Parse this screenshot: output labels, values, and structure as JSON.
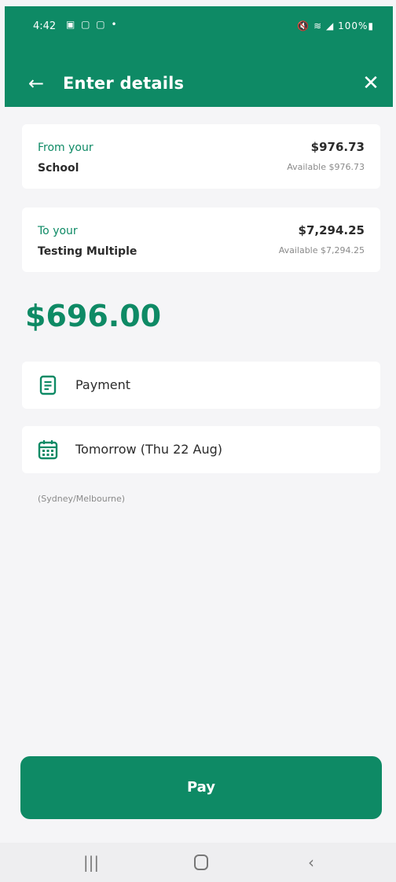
{
  "status_bar": {
    "time": "4:42",
    "notif_icons": "▣ ▢ ▢ •",
    "right": "🔇 ≋ ◢ 100%▮"
  },
  "header": {
    "title": "Enter details"
  },
  "from": {
    "label": "From your",
    "name": "School",
    "balance": "$976.73",
    "available": "Available $976.73"
  },
  "to": {
    "label": "To your",
    "name": "Testing Multiple",
    "balance": "$7,294.25",
    "available": "Available $7,294.25"
  },
  "amount": "$696.00",
  "description": {
    "text": "Payment",
    "icon": "document-icon"
  },
  "date": {
    "text": "Tomorrow (Thu 22 Aug)",
    "icon": "calendar-icon"
  },
  "timezone_note": "(Sydney/Melbourne)",
  "pay_button": "Pay",
  "colors": {
    "brand": "#0e8a65",
    "background": "#f5f5f7"
  }
}
